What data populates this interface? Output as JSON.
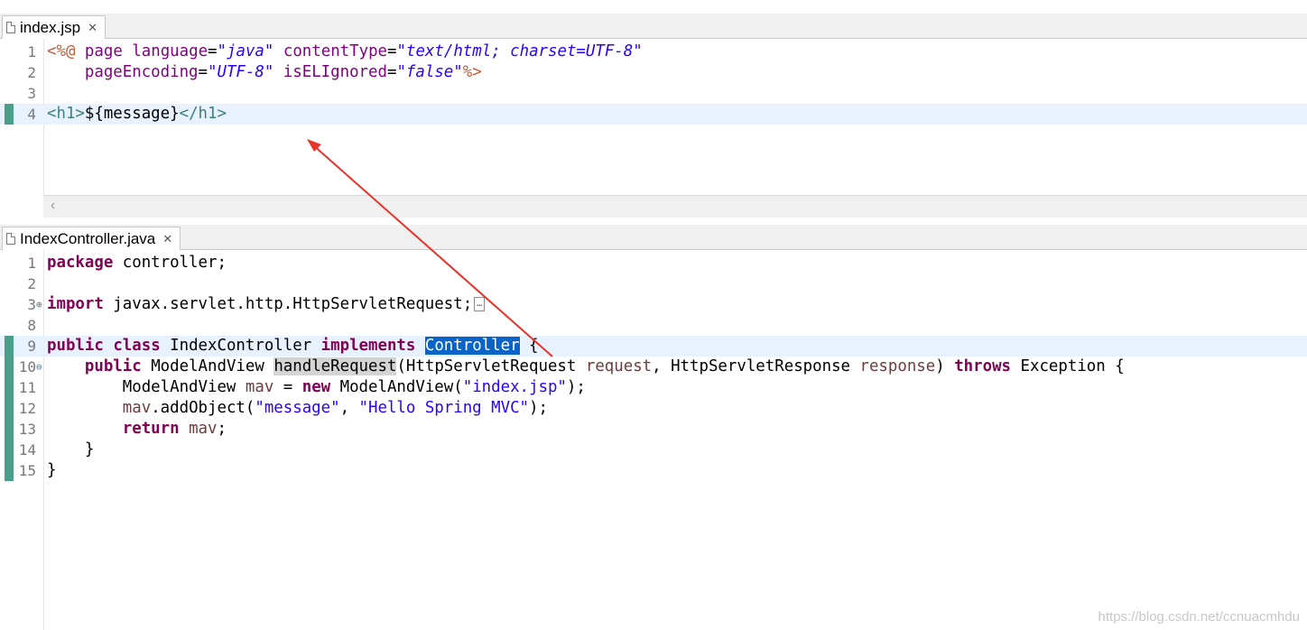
{
  "top_editor": {
    "tab_label": "index.jsp",
    "close_glyph": "✕",
    "line_numbers": [
      "1",
      "2",
      "3",
      "4"
    ],
    "lines": [
      [
        [
          "jsp",
          "<%@"
        ],
        [
          "plain",
          " "
        ],
        [
          "attr",
          "page"
        ],
        [
          "plain",
          " "
        ],
        [
          "attr",
          "language"
        ],
        [
          "plain",
          "="
        ],
        [
          "aval",
          "\"java\""
        ],
        [
          "plain",
          " "
        ],
        [
          "attr",
          "contentType"
        ],
        [
          "plain",
          "="
        ],
        [
          "aval",
          "\"text/html; charset=UTF-8\""
        ]
      ],
      [
        [
          "plain",
          "    "
        ],
        [
          "attr",
          "pageEncoding"
        ],
        [
          "plain",
          "="
        ],
        [
          "aval",
          "\"UTF-8\""
        ],
        [
          "plain",
          " "
        ],
        [
          "attr",
          "isELIgnored"
        ],
        [
          "plain",
          "="
        ],
        [
          "aval",
          "\"false\""
        ],
        [
          "jsp",
          "%>"
        ]
      ],
      [],
      [
        [
          "tag",
          "<h1>"
        ],
        [
          "plain",
          "${message}"
        ],
        [
          "tag",
          "</h1>"
        ]
      ]
    ]
  },
  "bottom_editor": {
    "tab_label": "IndexController.java",
    "close_glyph": "✕",
    "line_numbers": [
      "1",
      "2",
      "3",
      "8",
      "9",
      "10",
      "11",
      "12",
      "13",
      "14",
      "15"
    ],
    "lines": [
      [
        [
          "k",
          "package"
        ],
        [
          "plain",
          " controller;"
        ]
      ],
      [],
      [
        [
          "k",
          "import"
        ],
        [
          "plain",
          " javax.servlet.http.HttpServletRequest;"
        ],
        [
          "coll",
          "…"
        ]
      ],
      [],
      [
        [
          "k",
          "public"
        ],
        [
          "plain",
          " "
        ],
        [
          "k",
          "class"
        ],
        [
          "plain",
          " IndexController "
        ],
        [
          "k",
          "implements"
        ],
        [
          "plain",
          " "
        ],
        [
          "sel",
          "Controller"
        ],
        [
          "plain",
          " {"
        ]
      ],
      [
        [
          "plain",
          "    "
        ],
        [
          "k",
          "public"
        ],
        [
          "plain",
          " ModelAndView "
        ],
        [
          "occ",
          "handleRequest"
        ],
        [
          "plain",
          "(HttpServletRequest "
        ],
        [
          "v",
          "request"
        ],
        [
          "plain",
          ", HttpServletResponse "
        ],
        [
          "v",
          "response"
        ],
        [
          "plain",
          ") "
        ],
        [
          "k",
          "throws"
        ],
        [
          "plain",
          " Exception {"
        ]
      ],
      [
        [
          "plain",
          "        ModelAndView "
        ],
        [
          "v",
          "mav"
        ],
        [
          "plain",
          " = "
        ],
        [
          "k",
          "new"
        ],
        [
          "plain",
          " ModelAndView("
        ],
        [
          "s",
          "\"index.jsp\""
        ],
        [
          "plain",
          ");"
        ]
      ],
      [
        [
          "plain",
          "        "
        ],
        [
          "v",
          "mav"
        ],
        [
          "plain",
          ".addObject("
        ],
        [
          "s",
          "\"message\""
        ],
        [
          "plain",
          ", "
        ],
        [
          "s",
          "\"Hello Spring MVC\""
        ],
        [
          "plain",
          ");"
        ]
      ],
      [
        [
          "plain",
          "        "
        ],
        [
          "k",
          "return"
        ],
        [
          "plain",
          " "
        ],
        [
          "v",
          "mav"
        ],
        [
          "plain",
          ";"
        ]
      ],
      [
        [
          "plain",
          "    }"
        ]
      ],
      [
        [
          "plain",
          "}"
        ]
      ]
    ]
  },
  "scroll_left_glyph": "‹",
  "watermark": "https://blog.csdn.net/ccnuacmhdu"
}
